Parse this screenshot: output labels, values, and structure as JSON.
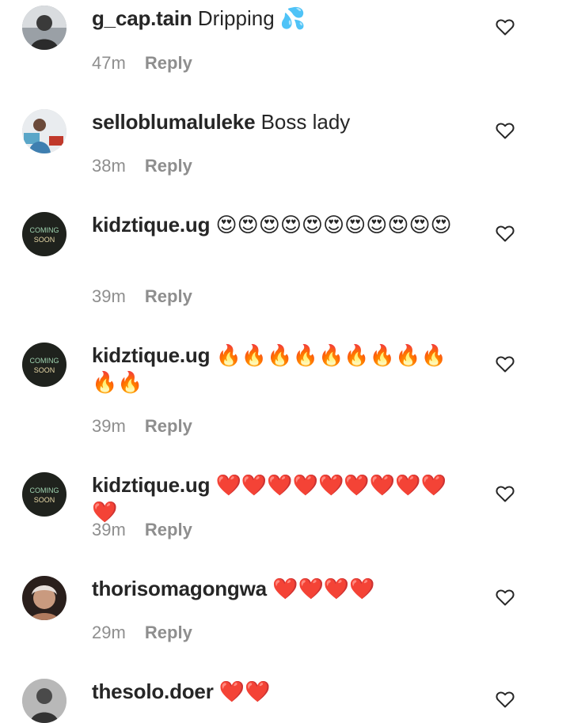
{
  "comments": [
    {
      "username": "g_cap.tain",
      "text": "Dripping 💦",
      "time": "47m",
      "reply_label": "Reply",
      "avatar_icon": "user-avatar-photo"
    },
    {
      "username": "selloblumaluleke",
      "text": "Boss lady",
      "time": "38m",
      "reply_label": "Reply",
      "avatar_icon": "user-avatar-photo"
    },
    {
      "username": "kidztique.ug",
      "text": "😍😍😍😍😍😍😍😍😍😍😍",
      "time": "39m",
      "reply_label": "Reply",
      "avatar_icon": "coming-soon-avatar",
      "avatar_text": [
        "COMING",
        "SOON"
      ]
    },
    {
      "username": "kidztique.ug",
      "text": "🔥🔥🔥🔥🔥🔥🔥🔥🔥🔥🔥",
      "time": "39m",
      "reply_label": "Reply",
      "avatar_icon": "coming-soon-avatar",
      "avatar_text": [
        "COMING",
        "SOON"
      ]
    },
    {
      "username": "kidztique.ug",
      "text": "❤️❤️❤️❤️❤️❤️❤️❤️❤️❤️",
      "time": "39m",
      "reply_label": "Reply",
      "avatar_icon": "coming-soon-avatar",
      "avatar_text": [
        "COMING",
        "SOON"
      ]
    },
    {
      "username": "thorisomagongwa",
      "text": "❤️❤️❤️❤️",
      "time": "29m",
      "reply_label": "Reply",
      "avatar_icon": "user-avatar-photo"
    },
    {
      "username": "thesolo.doer",
      "text": "❤️❤️",
      "time": "",
      "reply_label": "",
      "avatar_icon": "user-avatar-photo"
    }
  ],
  "colors": {
    "username": "#262626",
    "meta": "#8e8e8e",
    "heart_outline": "#262626",
    "background": "#ffffff"
  }
}
